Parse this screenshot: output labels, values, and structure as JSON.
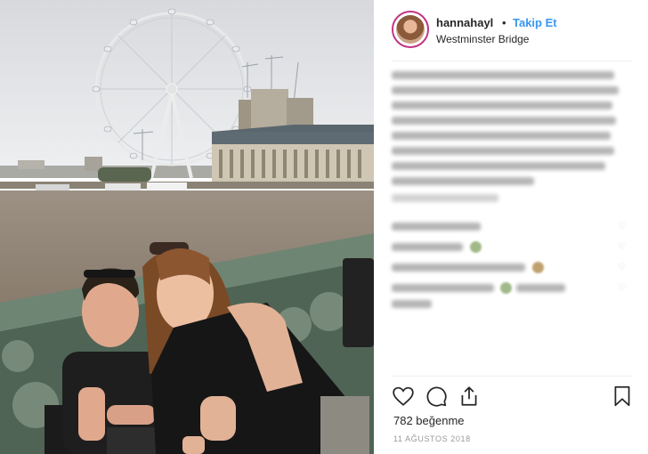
{
  "post": {
    "username": "hannahayl",
    "separator": "•",
    "follow_label": "Takip Et",
    "location": "Westminster Bridge",
    "likes": "782 beğenme",
    "date": "11 AĞUSTOS 2018"
  },
  "icons": {
    "like": "heart-icon",
    "comment": "comment-icon",
    "share": "share-icon",
    "save": "bookmark-icon"
  },
  "colors": {
    "follow": "#3897f0",
    "avatar_ring": "#c13584",
    "text": "#262626",
    "muted": "#999999"
  }
}
